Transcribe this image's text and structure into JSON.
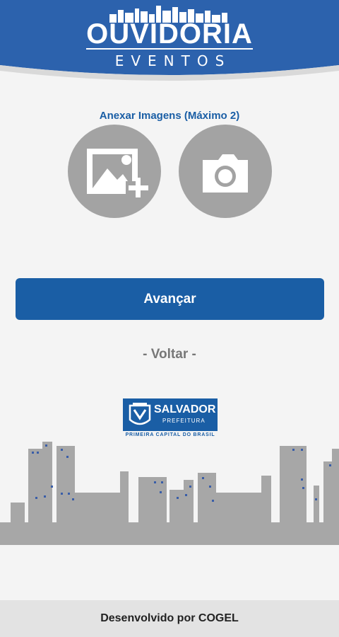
{
  "header": {
    "title": "OUVIDORIA",
    "subtitle": "EVENTOS"
  },
  "attachments": {
    "label": "Anexar Imagens (Máximo 2)",
    "gallery_icon": "image-add-icon",
    "camera_icon": "camera-icon"
  },
  "actions": {
    "next_label": "Avançar",
    "back_label": "- Voltar -"
  },
  "logo": {
    "name": "SALVADOR",
    "sub": "PREFEITURA",
    "tagline": "PRIMEIRA CAPITAL DO BRASIL"
  },
  "footer": {
    "text": "Desenvolvido por COGEL"
  },
  "colors": {
    "brand_blue": "#1a5ea5",
    "icon_gray": "#a3a3a3",
    "skyline_gray": "#a7a7a7"
  }
}
